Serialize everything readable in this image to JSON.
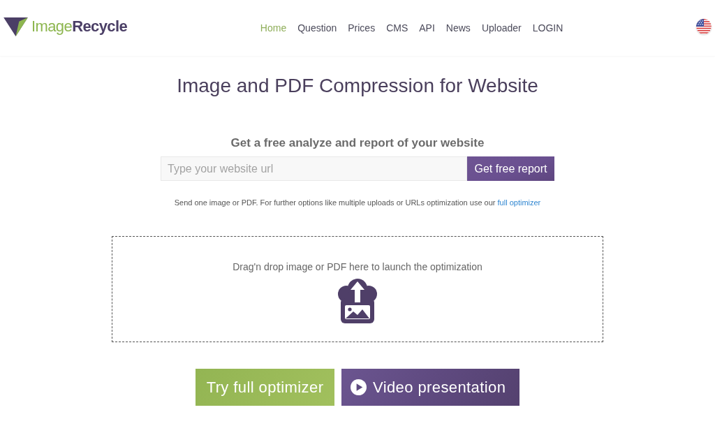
{
  "header": {
    "logo": "Image**Recycle**",
    "nav": [
      {
        "label": "Home",
        "selected": true
      },
      {
        "label": "Question",
        "selected": false
      },
      {
        "label": "Prices",
        "selected": false
      },
      {
        "label": "CMS",
        "selected": false
      },
      {
        "label": "API",
        "selected": false
      },
      {
        "label": "News",
        "selected": false
      },
      {
        "label": "Uploader",
        "selected": false
      },
      {
        "label": "LOGIN",
        "selected": false
      }
    ]
  },
  "hero": {
    "title": "Image and PDF Compression for Website"
  },
  "report": {
    "heading": "Get a free analyze and report of your website",
    "placeholder": "Type your website url",
    "button": "Get free report"
  },
  "note": {
    "text": "Send one image or PDF. For further options like multiple uploads or URLs optimization use our",
    "link": "full optimizer"
  },
  "dropzone": {
    "text": "Drag'n drop image or PDF here to launch the optimization"
  },
  "actions": [
    {
      "kind": "primary",
      "label": "Try full optimizer"
    },
    {
      "kind": "video",
      "label": "Video presentation"
    }
  ]
}
